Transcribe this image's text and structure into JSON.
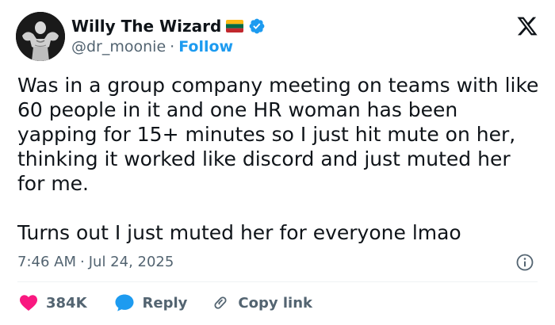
{
  "author": {
    "display_name": "Willy The Wizard",
    "handle": "@dr_moonie",
    "separator": "·",
    "follow_label": "Follow",
    "flag_icon": "lithuania-flag-icon",
    "verified_icon": "verified-badge-icon"
  },
  "tweet": {
    "text": "Was in a group company meeting on teams with like 60 people in it and one HR woman has been yapping for 15+ minutes so I just hit mute on her, thinking it worked like discord and just muted her for me.\n\nTurns out I just muted her for everyone lmao",
    "time": "7:46 AM",
    "separator": "·",
    "date": "Jul 24, 2025"
  },
  "actions": {
    "like_count": "384K",
    "reply_label": "Reply",
    "copy_label": "Copy link"
  },
  "colors": {
    "link_blue": "#1d9bf0",
    "like_red": "#f91880",
    "reply_blue": "#1d9bf0",
    "muted_text": "#536471",
    "text": "#0f1419"
  }
}
